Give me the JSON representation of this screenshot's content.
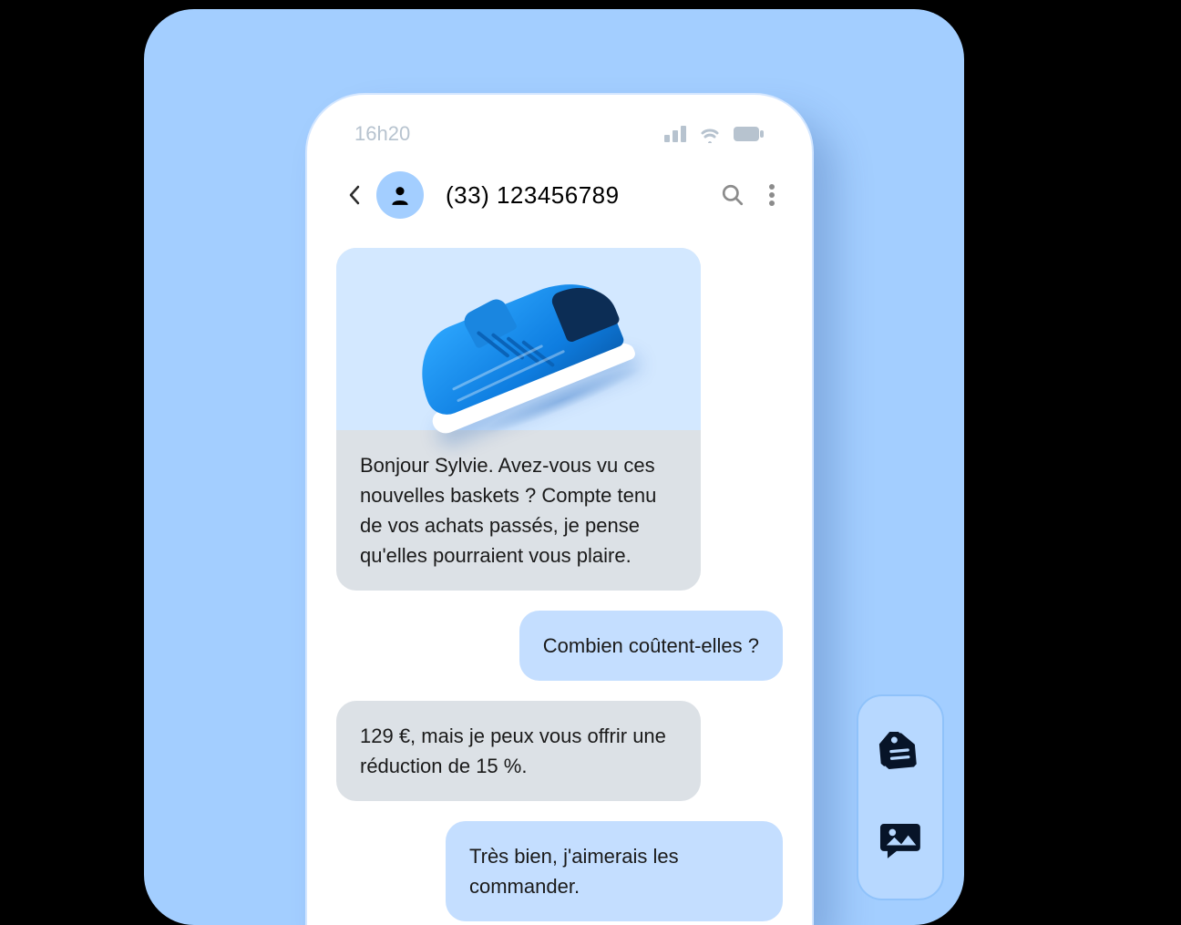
{
  "status_bar": {
    "time": "16h20"
  },
  "chat_header": {
    "phone_number": "(33) 123456789"
  },
  "messages": {
    "m1_product_text": "Bonjour Sylvie. Avez-vous vu ces nouvelles baskets ? Compte tenu de vos achats passés, je pense qu'elles pourraient vous plaire.",
    "m2_user": "Combien coûtent-elles ?",
    "m3_agent": "129 €, mais je peux vous offrir une réduction de 15 %.",
    "m4_user": "Très bien, j'aimerais les commander."
  },
  "colors": {
    "stage_bg": "#a3ceff",
    "bubble_agent": "#dce1e6",
    "bubble_user": "#c4deff"
  }
}
